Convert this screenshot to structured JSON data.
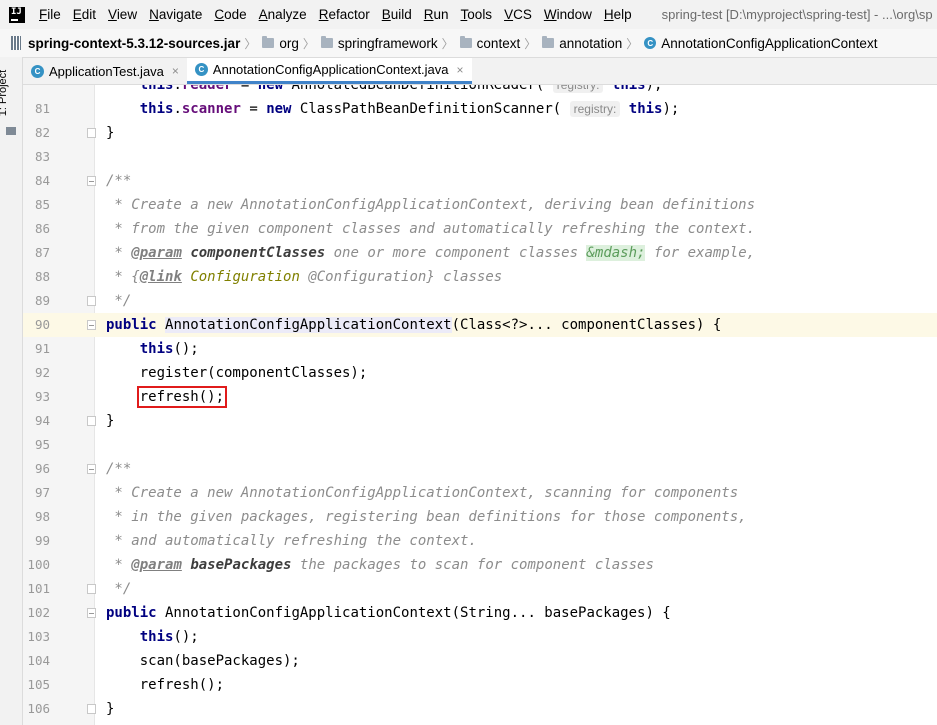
{
  "menu": {
    "items": [
      "File",
      "Edit",
      "View",
      "Navigate",
      "Code",
      "Analyze",
      "Refactor",
      "Build",
      "Run",
      "Tools",
      "VCS",
      "Window",
      "Help"
    ],
    "title": "spring-test [D:\\myproject\\spring-test] - ...\\org\\sp"
  },
  "breadcrumb": {
    "jar": "spring-context-5.3.12-sources.jar",
    "org": "org",
    "springframework": "springframework",
    "context": "context",
    "annotation": "annotation",
    "class": "AnnotationConfigApplicationContext"
  },
  "toolstrip": {
    "project_label": "1: Project"
  },
  "tabs": [
    {
      "label": "ApplicationTest.java",
      "close": "×"
    },
    {
      "label": "AnnotationConfigApplicationContext.java",
      "close": "×"
    }
  ],
  "editor": {
    "current_line": 90,
    "lines": [
      {
        "n": "",
        "t": [
          [
            "kw",
            "this"
          ],
          [
            "",
            "."
          ],
          [
            "fld",
            "reader"
          ],
          [
            "",
            " = "
          ],
          [
            "kw",
            "new"
          ],
          [
            "",
            " AnnotatedBeanDefinitionReader( "
          ],
          [
            "hint",
            "registry:"
          ],
          [
            "",
            " "
          ],
          [
            "kw",
            "this"
          ],
          [
            "",
            ");"
          ]
        ]
      },
      {
        "n": "81",
        "t": [
          [
            "",
            "    "
          ],
          [
            "kw",
            "this"
          ],
          [
            "",
            "."
          ],
          [
            "fld",
            "scanner"
          ],
          [
            "",
            " = "
          ],
          [
            "kw",
            "new"
          ],
          [
            "",
            " ClassPathBeanDefinitionScanner( "
          ],
          [
            "hint",
            "registry:"
          ],
          [
            "",
            " "
          ],
          [
            "kw",
            "this"
          ],
          [
            "",
            ");"
          ]
        ]
      },
      {
        "n": "82",
        "t": [
          [
            "",
            "}"
          ]
        ]
      },
      {
        "n": "83",
        "t": []
      },
      {
        "n": "84",
        "t": [
          [
            "cmt",
            "/**"
          ]
        ]
      },
      {
        "n": "85",
        "t": [
          [
            "cmt",
            " * Create a new AnnotationConfigApplicationContext, deriving bean definitions"
          ]
        ]
      },
      {
        "n": "86",
        "t": [
          [
            "cmt",
            " * from the given component classes and automatically refreshing the context."
          ]
        ]
      },
      {
        "n": "87",
        "t": [
          [
            "cmt",
            " * "
          ],
          [
            "tag",
            "@param"
          ],
          [
            "cmt",
            " "
          ],
          [
            "tagv",
            "componentClasses"
          ],
          [
            "cmt",
            " one or more component classes "
          ],
          [
            "ent",
            "&mdash;"
          ],
          [
            "cmt",
            " for example,"
          ]
        ]
      },
      {
        "n": "88",
        "t": [
          [
            "cmt",
            " * {"
          ],
          [
            "tag",
            "@link"
          ],
          [
            "cmt",
            " "
          ],
          [
            "ref",
            "Configuration"
          ],
          [
            "cmt",
            " @Configuration} classes"
          ]
        ]
      },
      {
        "n": "89",
        "t": [
          [
            "cmt",
            " */"
          ]
        ]
      },
      {
        "n": "90",
        "t": [
          [
            "kw",
            "public"
          ],
          [
            "",
            " "
          ],
          [
            "hl",
            "AnnotationConfigApplicationContext"
          ],
          [
            "",
            "(Class<?>... componentClasses) {"
          ]
        ]
      },
      {
        "n": "91",
        "t": [
          [
            "",
            "    "
          ],
          [
            "kw",
            "this"
          ],
          [
            "",
            "();"
          ]
        ]
      },
      {
        "n": "92",
        "t": [
          [
            "",
            "    register(componentClasses);"
          ]
        ]
      },
      {
        "n": "93",
        "t": [
          [
            "",
            "    "
          ],
          [
            "redbox",
            "refresh();"
          ]
        ]
      },
      {
        "n": "94",
        "t": [
          [
            "",
            "}"
          ]
        ]
      },
      {
        "n": "95",
        "t": []
      },
      {
        "n": "96",
        "t": [
          [
            "cmt",
            "/**"
          ]
        ]
      },
      {
        "n": "97",
        "t": [
          [
            "cmt",
            " * Create a new AnnotationConfigApplicationContext, scanning for components"
          ]
        ]
      },
      {
        "n": "98",
        "t": [
          [
            "cmt",
            " * in the given packages, registering bean definitions for those components,"
          ]
        ]
      },
      {
        "n": "99",
        "t": [
          [
            "cmt",
            " * and automatically refreshing the context."
          ]
        ]
      },
      {
        "n": "100",
        "t": [
          [
            "cmt",
            " * "
          ],
          [
            "tag",
            "@param"
          ],
          [
            "cmt",
            " "
          ],
          [
            "tagv",
            "basePackages"
          ],
          [
            "cmt",
            " the packages to scan for component classes"
          ]
        ]
      },
      {
        "n": "101",
        "t": [
          [
            "cmt",
            " */"
          ]
        ]
      },
      {
        "n": "102",
        "t": [
          [
            "kw",
            "public"
          ],
          [
            "",
            " AnnotationConfigApplicationContext(String... basePackages) {"
          ]
        ]
      },
      {
        "n": "103",
        "t": [
          [
            "",
            "    "
          ],
          [
            "kw",
            "this"
          ],
          [
            "",
            "();"
          ]
        ]
      },
      {
        "n": "104",
        "t": [
          [
            "",
            "    scan(basePackages);"
          ]
        ]
      },
      {
        "n": "105",
        "t": [
          [
            "",
            "    refresh();"
          ]
        ]
      },
      {
        "n": "106",
        "t": [
          [
            "",
            "}"
          ]
        ]
      }
    ]
  }
}
